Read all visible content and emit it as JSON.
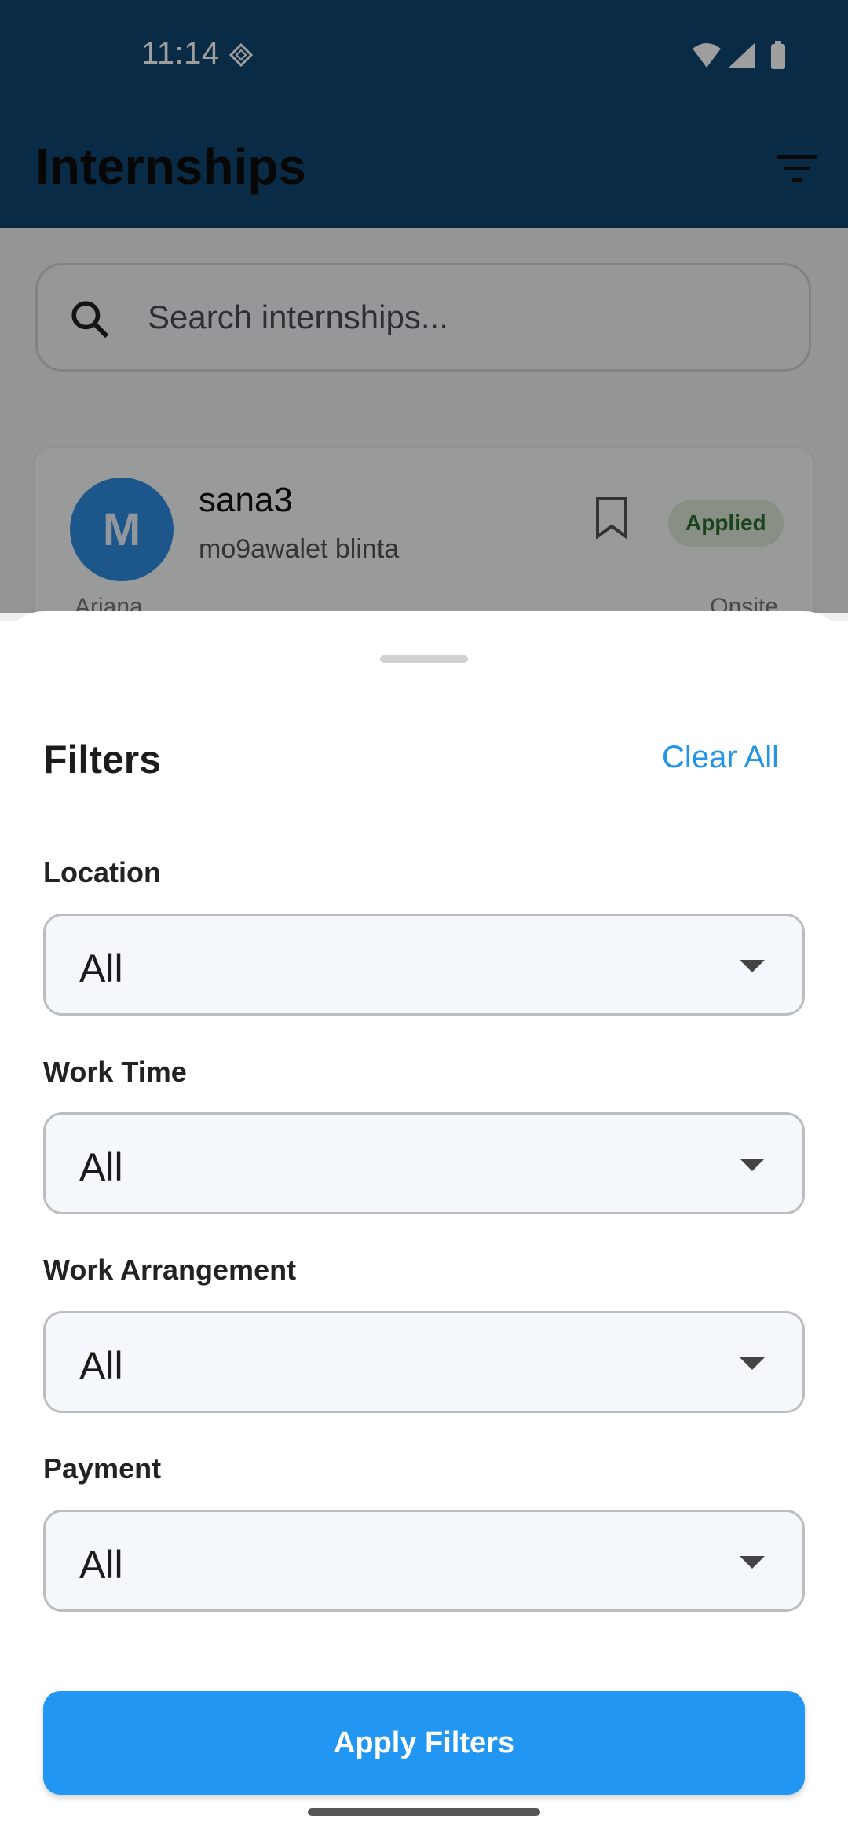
{
  "status_bar": {
    "time": "11:14"
  },
  "app_bar": {
    "title": "Internships"
  },
  "search": {
    "placeholder": "Search internships..."
  },
  "card": {
    "avatar_letter": "M",
    "title": "sana3",
    "company": "mo9awalet blinta",
    "status": "Applied",
    "location": "Ariana",
    "type": "Onsite"
  },
  "sheet": {
    "title": "Filters",
    "clear_label": "Clear All",
    "fields": [
      {
        "label": "Location",
        "value": "All"
      },
      {
        "label": "Work Time",
        "value": "All"
      },
      {
        "label": "Work Arrangement",
        "value": "All"
      },
      {
        "label": "Payment",
        "value": "All"
      }
    ],
    "apply_label": "Apply Filters"
  },
  "colors": {
    "app_bar": "#114672",
    "accent": "#2196f3",
    "badge_bg": "#dbe8d8",
    "badge_text": "#2a6b31"
  }
}
